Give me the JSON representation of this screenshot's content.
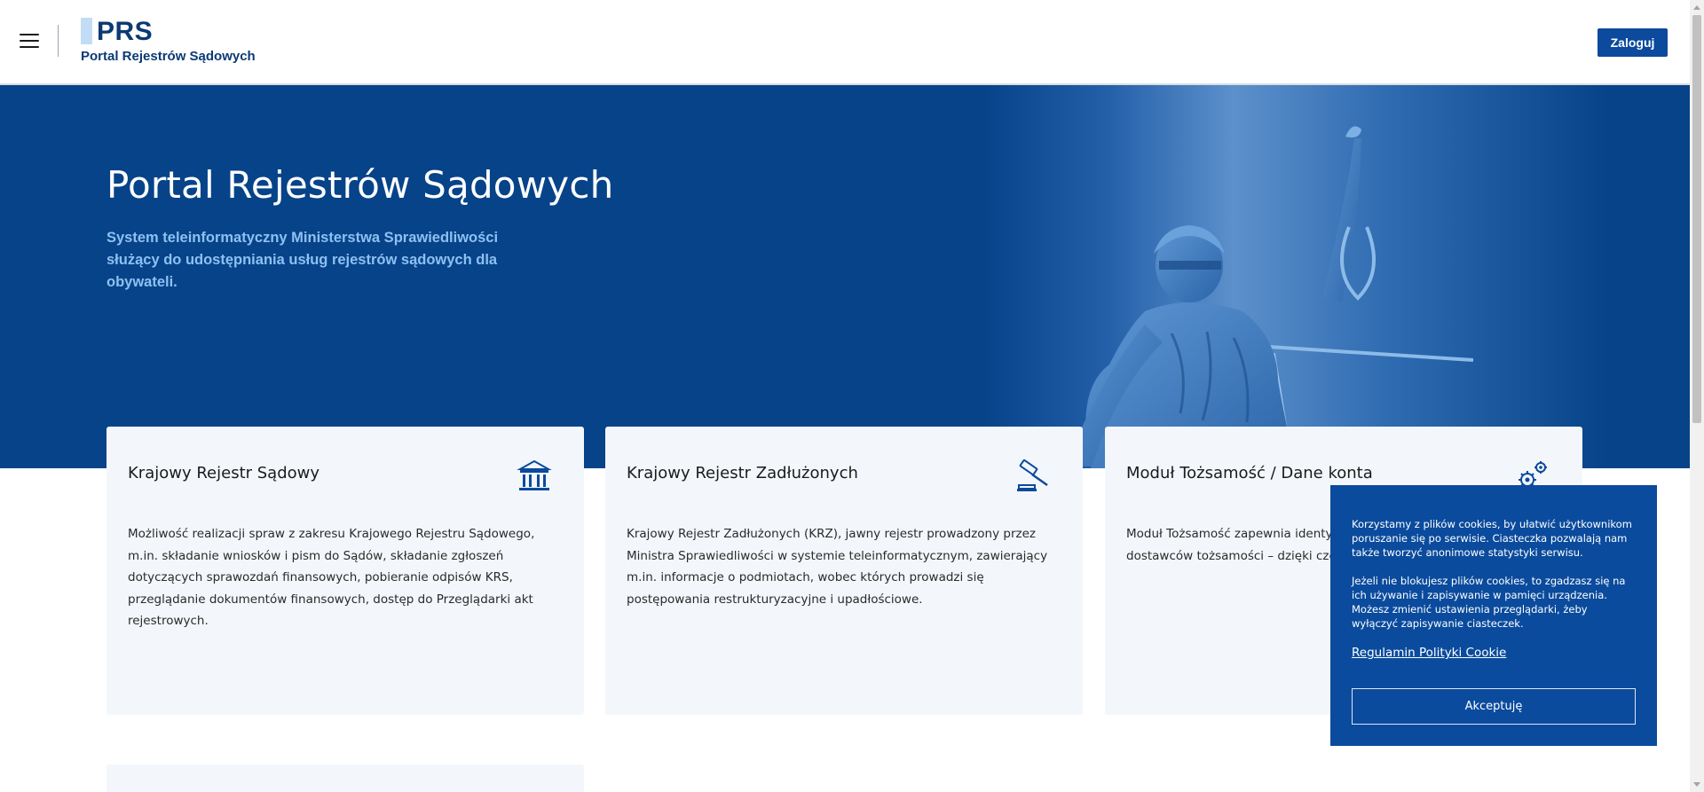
{
  "header": {
    "logo_text": "PRS",
    "logo_subtitle": "Portal Rejestrów Sądowych",
    "login_label": "Zaloguj"
  },
  "hero": {
    "title": "Portal Rejestrów Sądowych",
    "description": "System teleinformatyczny Ministerstwa Sprawiedliwości służący do udostępniania usług rejestrów sądowych dla obywateli."
  },
  "cards": [
    {
      "title": "Krajowy Rejestr Sądowy",
      "icon": "courthouse-icon",
      "description": "Możliwość realizacji spraw z zakresu Krajowego Rejestru Sądowego, m.in. składanie wniosków i pism do Sądów, składanie zgłoszeń dotyczących sprawozdań finansowych, pobieranie odpisów KRS, przeglądanie dokumentów finansowych, dostęp do Przeglądarki akt rejestrowych."
    },
    {
      "title": "Krajowy Rejestr Zadłużonych",
      "icon": "gavel-icon",
      "description": "Krajowy Rejestr Zadłużonych (KRZ), jawny rejestr prowadzony przez Ministra Sprawiedliwości w systemie teleinformatycznym, zawierający m.in. informacje o podmiotach, wobec których prowadzi się postępowania restrukturyzacyjne i upadłościowe."
    },
    {
      "title": "Moduł Tożsamość / Dane konta",
      "icon": "gears-icon",
      "description": "Moduł Tożsamość zapewnia identy Ministerstwa Sprawiedliwości przy dostawców tożsamości – dzięki czel zakładania użytkownikowi osobnyc"
    }
  ],
  "cookie": {
    "paragraph1": "Korzystamy z plików cookies, by ułatwić użytkownikom poruszanie się po serwisie. Ciasteczka pozwalają nam także tworzyć anonimowe statystyki serwisu.",
    "paragraph2": "Jeżeli nie blokujesz plików cookies, to zgadzasz się na ich używanie i zapisywanie w pamięci urządzenia. Możesz zmienić ustawienia przeglądarki, żeby wyłączyć zapisywanie ciasteczek.",
    "policy_link": "Regulamin Polityki Cookie",
    "accept_label": "Akceptuję"
  },
  "colors": {
    "brand_blue": "#074389",
    "button_blue": "#0b4a9c",
    "hero_subtitle": "#8ec1f1",
    "card_bg": "#f3f7fb"
  }
}
